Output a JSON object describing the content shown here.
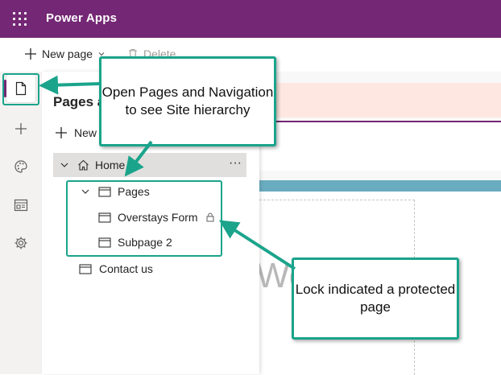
{
  "app": {
    "title": "Power Apps"
  },
  "toolbar": {
    "new_page_label": "New page",
    "delete_label": "Delete"
  },
  "left_rail": {
    "items": [
      {
        "name": "pages",
        "icon": "page-icon",
        "active": true
      },
      {
        "name": "add",
        "icon": "plus-icon"
      },
      {
        "name": "themes",
        "icon": "palette-icon"
      },
      {
        "name": "components",
        "icon": "layout-icon"
      },
      {
        "name": "settings",
        "icon": "gear-icon"
      }
    ]
  },
  "panel": {
    "title": "Pages and",
    "new_label": "New page",
    "more_label": "···",
    "tree": [
      {
        "label": "Home",
        "level": 0,
        "expanded": true,
        "selected": true,
        "icon": "home-icon"
      },
      {
        "label": "Pages",
        "level": 1,
        "expanded": true,
        "icon": "page-frame-icon"
      },
      {
        "label": "Overstays Form",
        "level": 2,
        "locked": true,
        "icon": "page-frame-icon"
      },
      {
        "label": "Subpage 2",
        "level": 2,
        "icon": "page-frame-icon"
      },
      {
        "label": "Contact us",
        "level": 0,
        "icon": "page-frame-icon"
      }
    ]
  },
  "canvas": {
    "welcome_text": "We"
  },
  "callouts": {
    "top": "Open Pages and Navigation to see Site hierarchy",
    "bottom": "Lock indicated a protected page"
  },
  "colors": {
    "brand": "#742774",
    "callout_border": "#1aa48b",
    "banner": "#fde7e0",
    "blue_bar": "#6aacbf"
  }
}
